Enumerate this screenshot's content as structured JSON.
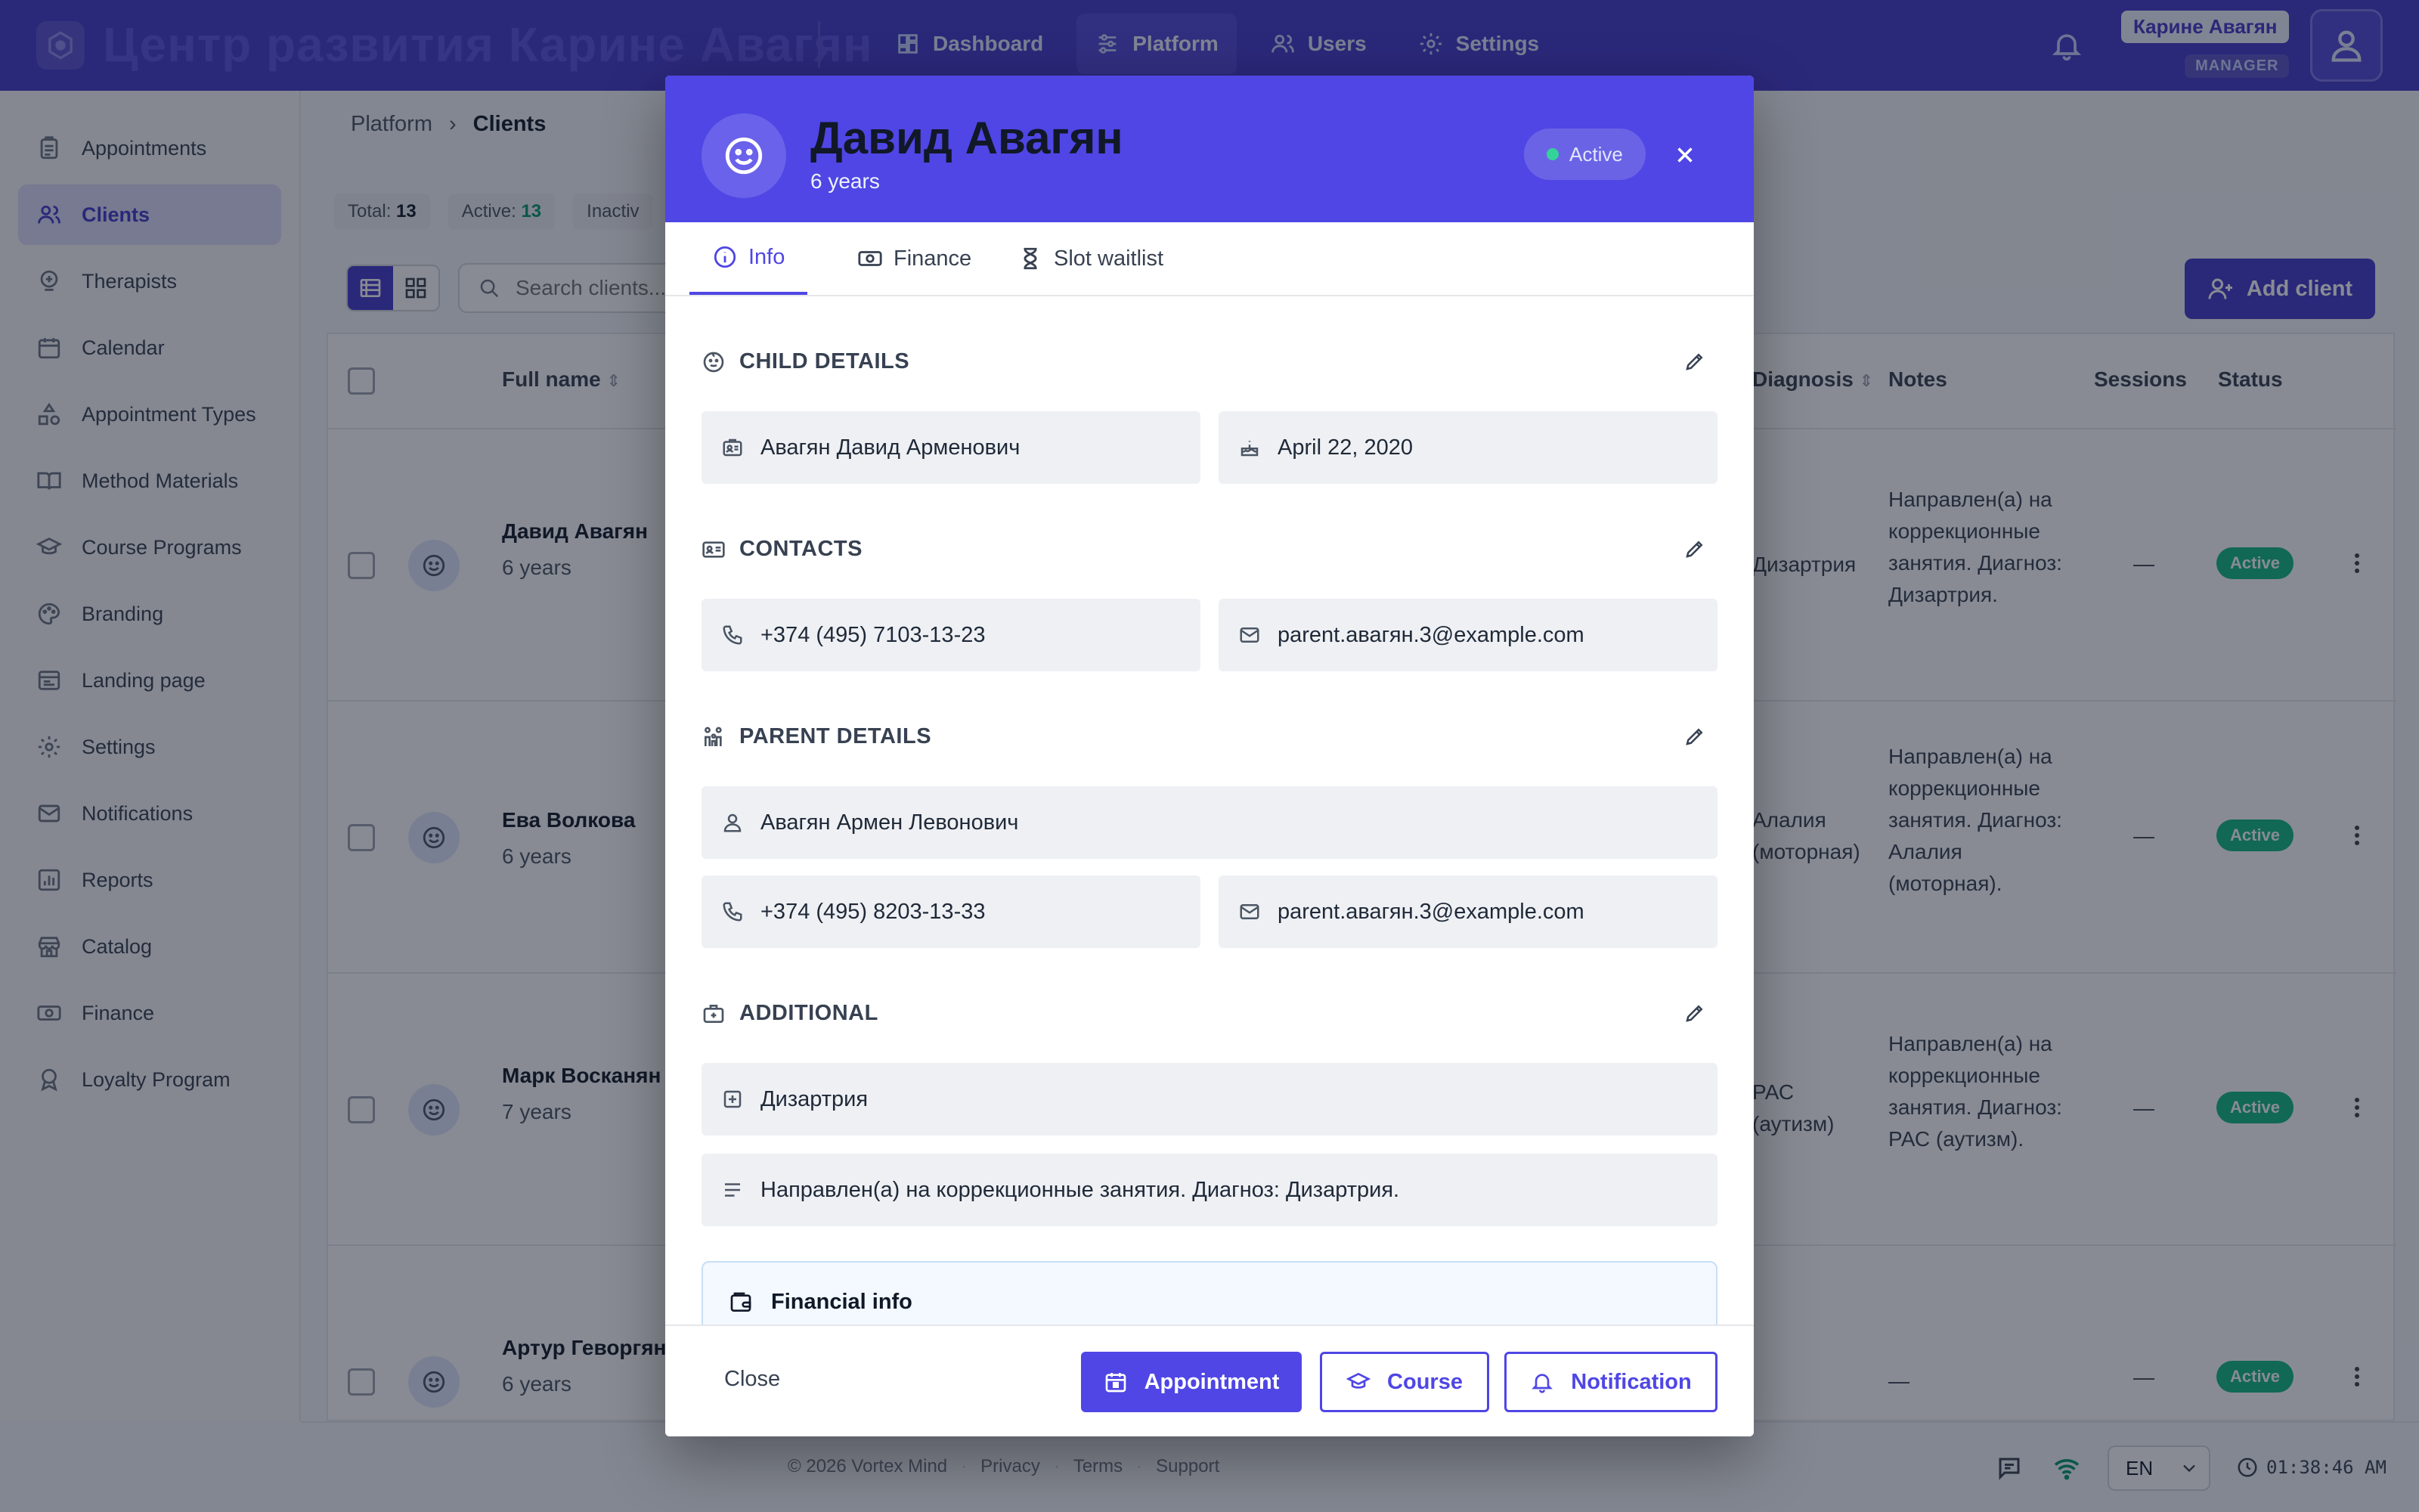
{
  "app": {
    "brand_title": "Центр развития Карине Авагян",
    "user_name": "Карине Авагян",
    "user_role": "MANAGER",
    "nav": [
      {
        "label": "Dashboard",
        "icon": "dashboard-icon",
        "active": false
      },
      {
        "label": "Platform",
        "icon": "sliders-icon",
        "active": true
      },
      {
        "label": "Users",
        "icon": "users-icon",
        "active": false
      },
      {
        "label": "Settings",
        "icon": "gear-icon",
        "active": false
      }
    ]
  },
  "sidebar": {
    "items": [
      {
        "label": "Appointments",
        "icon": "clipboard-icon",
        "active": false
      },
      {
        "label": "Clients",
        "icon": "users-icon",
        "active": true
      },
      {
        "label": "Therapists",
        "icon": "therapist-icon",
        "active": false
      },
      {
        "label": "Calendar",
        "icon": "calendar-icon",
        "active": false
      },
      {
        "label": "Appointment Types",
        "icon": "shapes-icon",
        "active": false
      },
      {
        "label": "Method Materials",
        "icon": "book-icon",
        "active": false
      },
      {
        "label": "Course Programs",
        "icon": "graduation-cap-icon",
        "active": false
      },
      {
        "label": "Branding",
        "icon": "palette-icon",
        "active": false
      },
      {
        "label": "Landing page",
        "icon": "landing-page-icon",
        "active": false
      },
      {
        "label": "Settings",
        "icon": "gear-icon",
        "active": false
      },
      {
        "label": "Notifications",
        "icon": "mail-icon",
        "active": false
      },
      {
        "label": "Reports",
        "icon": "reports-icon",
        "active": false
      },
      {
        "label": "Catalog",
        "icon": "store-icon",
        "active": false
      },
      {
        "label": "Finance",
        "icon": "cash-icon",
        "active": false
      },
      {
        "label": "Loyalty Program",
        "icon": "award-icon",
        "active": false
      }
    ]
  },
  "main": {
    "breadcrumb": {
      "parent": "Platform",
      "current": "Clients"
    },
    "stats": {
      "total_label": "Total:",
      "total_value": "13",
      "active_label": "Active:",
      "active_value": "13",
      "inactive_label": "Inactiv"
    },
    "search_placeholder": "Search clients...",
    "add_client_label": "Add client",
    "columns": {
      "full_name": "Full name",
      "diagnosis": "Diagnosis",
      "notes": "Notes",
      "sessions": "Sessions",
      "status": "Status"
    },
    "rows": [
      {
        "name": "Давид Авагян",
        "age": "6 years",
        "diagnosis": "Дизартрия",
        "notes": "Направлен(а) на коррекционные занятия. Диагноз: Дизартрия.",
        "sessions": "—",
        "status": "Active"
      },
      {
        "name": "Ева Волкова",
        "age": "6 years",
        "diagnosis": "Алалия (моторная)",
        "notes": "Направлен(а) на коррекционные занятия. Диагноз: Алалия (моторная).",
        "sessions": "—",
        "status": "Active"
      },
      {
        "name": "Марк Восканян",
        "age": "7 years",
        "diagnosis": "РАС (аутизм)",
        "notes": "Направлен(а) на коррекционные занятия. Диагноз: РАС (аутизм).",
        "sessions": "—",
        "status": "Active"
      },
      {
        "name": "Артур Геворгян",
        "age": "6 years",
        "diagnosis": "",
        "notes": "—",
        "sessions": "—",
        "status": "Active"
      }
    ]
  },
  "footer": {
    "copyright": "© 2026 Vortex Mind",
    "links": [
      "Privacy",
      "Terms",
      "Support"
    ],
    "language": "EN",
    "time": "01:38:46 AM"
  },
  "modal": {
    "name": "Давид Авагян",
    "age": "6 years",
    "status": "Active",
    "tabs": [
      {
        "label": "Info",
        "icon": "info-icon",
        "active": true
      },
      {
        "label": "Finance",
        "icon": "cash-icon",
        "active": false
      },
      {
        "label": "Slot waitlist",
        "icon": "hourglass-icon",
        "active": false
      }
    ],
    "sections": {
      "child_details": "CHILD DETAILS",
      "contacts": "CONTACTS",
      "parent_details": "PARENT DETAILS",
      "additional": "ADDITIONAL"
    },
    "child": {
      "full_name": "Авагян Давид Арменович",
      "birthday": "April 22, 2020"
    },
    "contacts": {
      "phone": "+374 (495) 7103-13-23",
      "email": "parent.авагян.3@example.com"
    },
    "parent": {
      "full_name": "Авагян Армен Левонович",
      "phone": "+374 (495) 8203-13-33",
      "email": "parent.авагян.3@example.com"
    },
    "additional": {
      "diagnosis": "Дизартрия",
      "notes": "Направлен(а) на коррекционные занятия. Диагноз: Дизартрия."
    },
    "financial_info_title": "Financial info",
    "footer": {
      "close": "Close",
      "appointment": "Appointment",
      "course": "Course",
      "notification": "Notification"
    }
  },
  "colors": {
    "brand": "#4338ca",
    "modal_header": "#4f46e5",
    "status_green": "#10b981"
  }
}
